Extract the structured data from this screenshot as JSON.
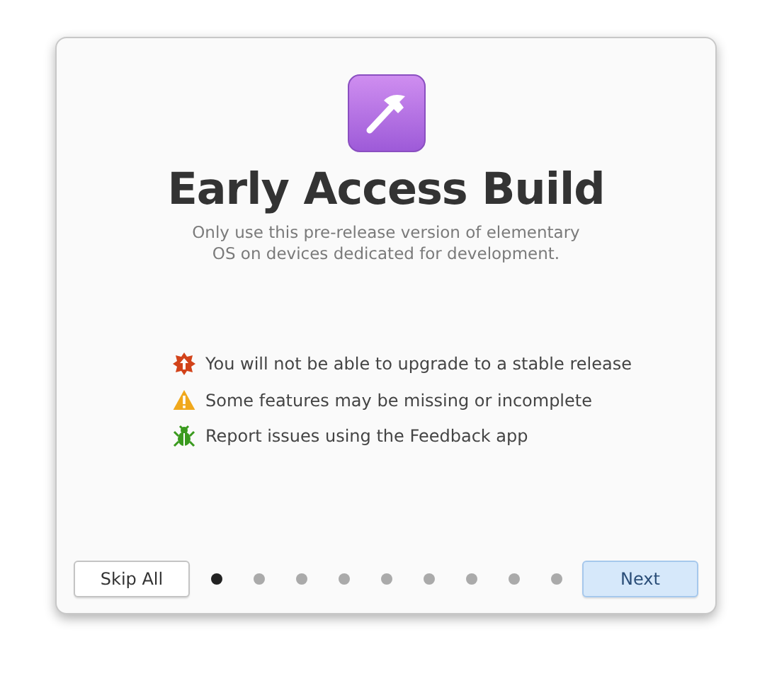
{
  "title": "Early Access Build",
  "subtitle": "Only use this pre-release version of elementary OS on devices dedicated for development.",
  "notices": [
    {
      "kind": "upgrade",
      "text": "You will not be able to upgrade to a stable release"
    },
    {
      "kind": "warning",
      "text": "Some features may be missing or incomplete"
    },
    {
      "kind": "bug",
      "text": "Report issues using the Feedback app"
    }
  ],
  "skip_button": "Skip All",
  "pages": [
    {
      "selected": true
    },
    {
      "selected": false
    },
    {
      "selected": false
    },
    {
      "selected": false
    },
    {
      "selected": false
    },
    {
      "selected": false
    },
    {
      "selected": false
    },
    {
      "selected": false
    },
    {
      "selected": false
    }
  ],
  "next_button": "Next"
}
